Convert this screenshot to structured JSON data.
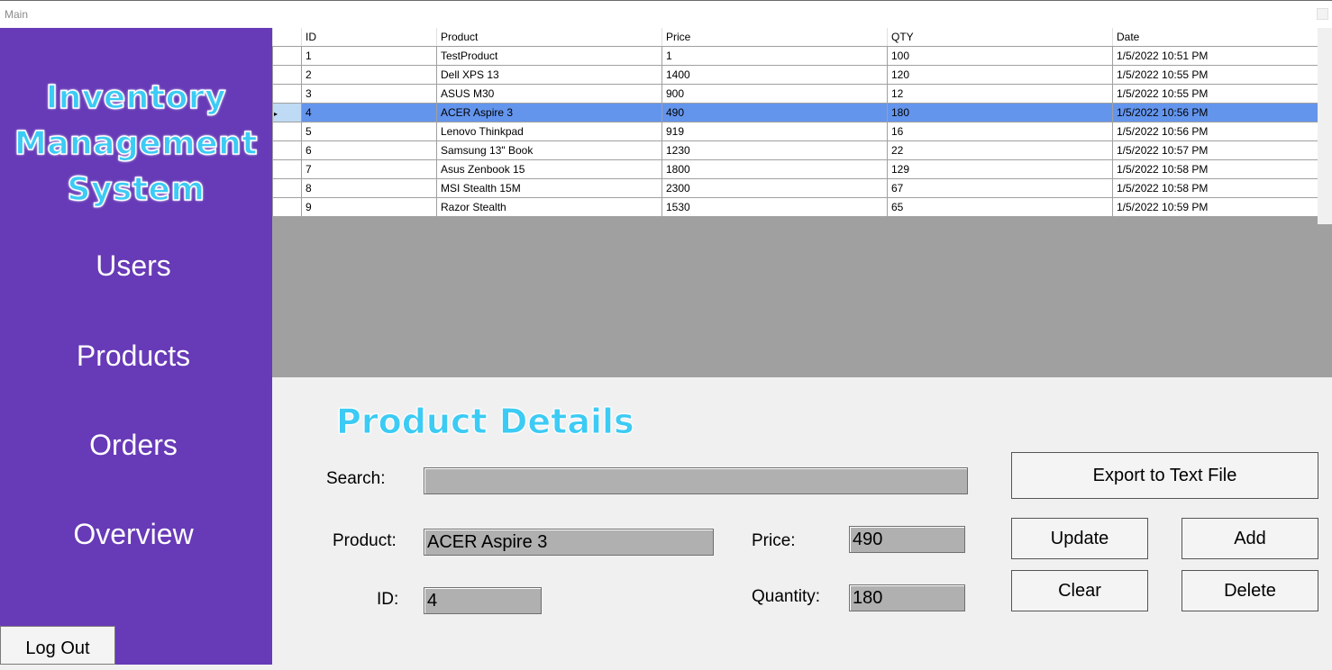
{
  "window": {
    "title": "Main"
  },
  "sidebar": {
    "logo_lines": [
      "Inventory",
      "Management",
      "System"
    ],
    "items": [
      {
        "label": "Users"
      },
      {
        "label": "Products"
      },
      {
        "label": "Orders"
      },
      {
        "label": "Overview"
      }
    ],
    "logout_label": "Log Out"
  },
  "grid": {
    "columns": [
      "ID",
      "Product",
      "Price",
      "QTY",
      "Date"
    ],
    "selected_row_index": 3,
    "rows": [
      {
        "id": "1",
        "product": "TestProduct",
        "price": "1",
        "qty": "100",
        "date": "1/5/2022 10:51 PM"
      },
      {
        "id": "2",
        "product": "Dell XPS 13",
        "price": "1400",
        "qty": "120",
        "date": "1/5/2022 10:55 PM"
      },
      {
        "id": "3",
        "product": "ASUS M30",
        "price": "900",
        "qty": "12",
        "date": "1/5/2022 10:55 PM"
      },
      {
        "id": "4",
        "product": "ACER Aspire 3",
        "price": "490",
        "qty": "180",
        "date": "1/5/2022 10:56 PM"
      },
      {
        "id": "5",
        "product": "Lenovo Thinkpad",
        "price": "919",
        "qty": "16",
        "date": "1/5/2022 10:56 PM"
      },
      {
        "id": "6",
        "product": "Samsung 13\" Book",
        "price": "1230",
        "qty": "22",
        "date": "1/5/2022 10:57 PM"
      },
      {
        "id": "7",
        "product": "Asus Zenbook 15",
        "price": "1800",
        "qty": "129",
        "date": "1/5/2022 10:58 PM"
      },
      {
        "id": "8",
        "product": "MSI Stealth 15M",
        "price": "2300",
        "qty": "67",
        "date": "1/5/2022 10:58 PM"
      },
      {
        "id": "9",
        "product": "Razor Stealth",
        "price": "1530",
        "qty": "65",
        "date": "1/5/2022 10:59 PM"
      }
    ]
  },
  "details": {
    "title": "Product Details",
    "search_label": "Search:",
    "search_value": "",
    "product_label": "Product:",
    "product_value": "ACER Aspire 3",
    "id_label": "ID:",
    "id_value": "4",
    "price_label": "Price:",
    "price_value": "490",
    "quantity_label": "Quantity:",
    "quantity_value": "180"
  },
  "actions": {
    "export_label": "Export to Text File",
    "update_label": "Update",
    "add_label": "Add",
    "clear_label": "Clear",
    "delete_label": "Delete"
  },
  "colors": {
    "sidebar": "#673ab7",
    "logo_text": "#3ccbf4",
    "selected_row": "#6495ed",
    "grid_background": "#a0a0a0",
    "field_background": "#b0b0b0"
  }
}
